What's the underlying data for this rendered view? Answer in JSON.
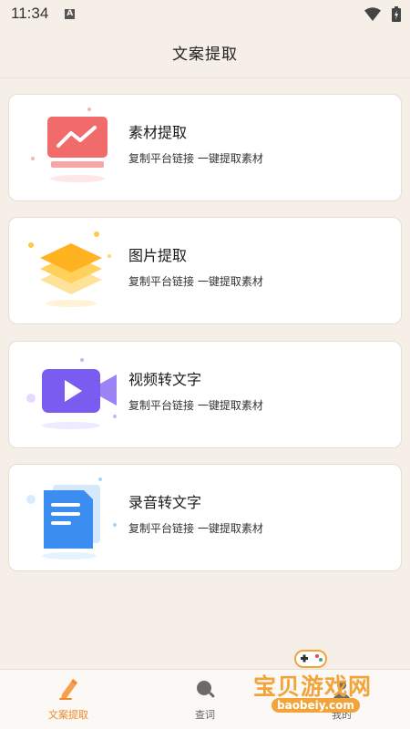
{
  "status_bar": {
    "time": "11:34",
    "notification_icon": "a-notification-icon",
    "wifi_icon": "wifi-icon",
    "battery_icon": "battery-icon",
    "notification_glyph": "A"
  },
  "header": {
    "title": "文案提取"
  },
  "cards": [
    {
      "title": "素材提取",
      "desc": "复制平台链接 一键提取素材",
      "icon": "chart-screen-icon"
    },
    {
      "title": "图片提取",
      "desc": "复制平台链接 一键提取素材",
      "icon": "layers-icon"
    },
    {
      "title": "视频转文字",
      "desc": "复制平台链接 一键提取素材",
      "icon": "video-camera-icon"
    },
    {
      "title": "录音转文字",
      "desc": "复制平台链接 一键提取素材",
      "icon": "document-icon"
    }
  ],
  "tabs": [
    {
      "label": "文案提取",
      "icon": "pencil-icon",
      "active": true
    },
    {
      "label": "查词",
      "icon": "search-icon",
      "active": false
    },
    {
      "label": "我的",
      "icon": "user-icon",
      "active": false
    }
  ],
  "watermark": {
    "text": "宝贝游戏网",
    "url": "baobeiy.com"
  },
  "colors": {
    "accent": "#f08a2a",
    "background": "#f5efe8"
  }
}
